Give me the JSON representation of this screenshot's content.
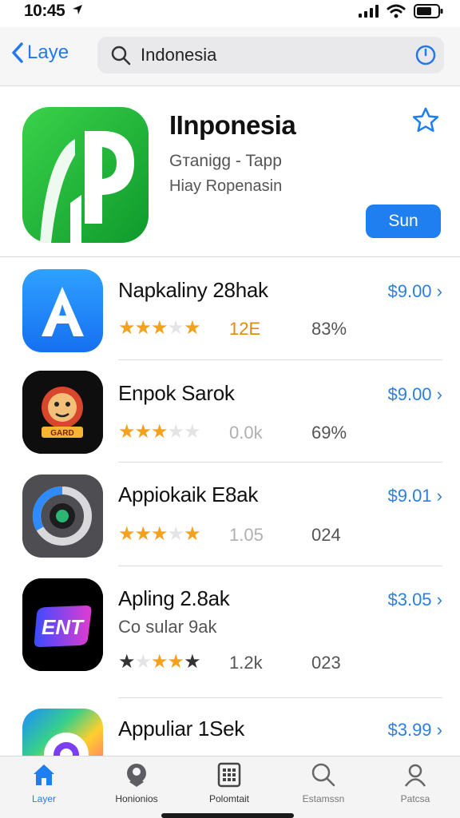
{
  "status": {
    "time": "10:45"
  },
  "nav": {
    "back_label": "Laye",
    "search_value": "Indonesia"
  },
  "featured": {
    "title": "IInponesia",
    "subtitle1": "Gтаnigg - Tapp",
    "subtitle2": "Hiay Ropenasin",
    "get_label": "Sun"
  },
  "apps": [
    {
      "name": "Napkaliny 28hak",
      "price": "$9.00",
      "stars": "on,on,on,off,on",
      "count": "12E",
      "pct": "83%"
    },
    {
      "name": "Enpok Sarok",
      "price": "$9.00",
      "stars": "on,on,on,off,off",
      "count": "0.0k",
      "pct": "69%"
    },
    {
      "name": "Appiokaik E8ak",
      "price": "$9.01",
      "stars": "on,on,on,off,on",
      "count": "1.05",
      "pct": "024"
    },
    {
      "name": "Apling 2.8ak",
      "sub": "Co sular 9ak",
      "price": "$3.05",
      "stars": "dark,off,on,on,dark",
      "count": "1.2k",
      "pct": "023"
    },
    {
      "name": "Appuliar 1Sek",
      "price": "$3.99"
    }
  ],
  "app4_icon_text": "ENT",
  "tabs": [
    {
      "label": "Layer"
    },
    {
      "label": "Honionios"
    },
    {
      "label": "Polomtait"
    },
    {
      "label": "Estamssn"
    },
    {
      "label": "Patcsa"
    }
  ],
  "colors": {
    "accent": "#1f7ff1",
    "star": "#f4a11d",
    "price": "#2a7fe0"
  }
}
